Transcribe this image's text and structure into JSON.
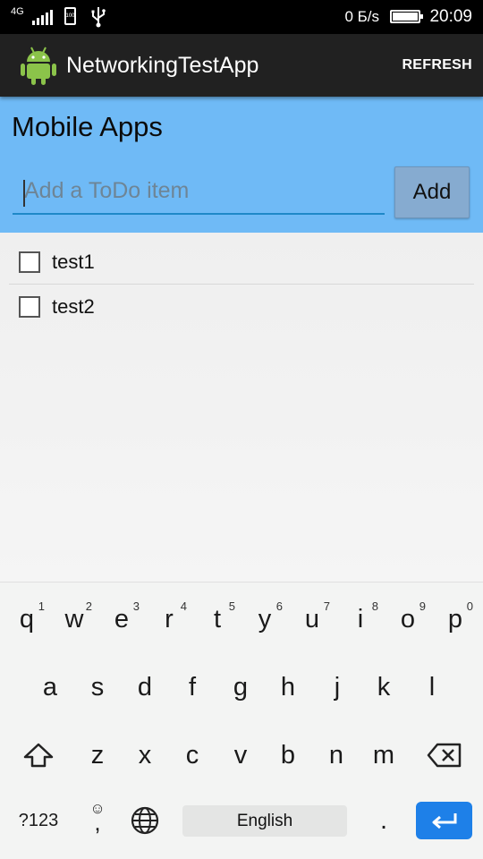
{
  "status_bar": {
    "network": "4G",
    "battery_small_text": "100",
    "net_speed": "0 Б/s",
    "time": "20:09"
  },
  "action_bar": {
    "title": "NetworkingTestApp",
    "refresh_label": "REFRESH",
    "icon": "android-robot-icon"
  },
  "header": {
    "title": "Mobile Apps",
    "input_placeholder": "Add a ToDo item",
    "input_value": "",
    "add_label": "Add"
  },
  "todo_items": [
    {
      "label": "test1",
      "checked": false
    },
    {
      "label": "test2",
      "checked": false
    }
  ],
  "keyboard": {
    "row1": [
      {
        "k": "q",
        "n": "1"
      },
      {
        "k": "w",
        "n": "2"
      },
      {
        "k": "e",
        "n": "3"
      },
      {
        "k": "r",
        "n": "4"
      },
      {
        "k": "t",
        "n": "5"
      },
      {
        "k": "y",
        "n": "6"
      },
      {
        "k": "u",
        "n": "7"
      },
      {
        "k": "i",
        "n": "8"
      },
      {
        "k": "o",
        "n": "9"
      },
      {
        "k": "p",
        "n": "0"
      }
    ],
    "row2": [
      "a",
      "s",
      "d",
      "f",
      "g",
      "h",
      "j",
      "k",
      "l"
    ],
    "row3": [
      "z",
      "x",
      "c",
      "v",
      "b",
      "n",
      "m"
    ],
    "symbols_label": "?123",
    "comma_label": ",",
    "period_label": ".",
    "space_label": "English",
    "icons": [
      "shift-icon",
      "backspace-icon",
      "emoji-icon",
      "globe-icon",
      "enter-icon"
    ]
  },
  "colors": {
    "accent_header": "#6fbaf6",
    "action_bar": "#212121",
    "enter_key": "#1e80e8"
  }
}
